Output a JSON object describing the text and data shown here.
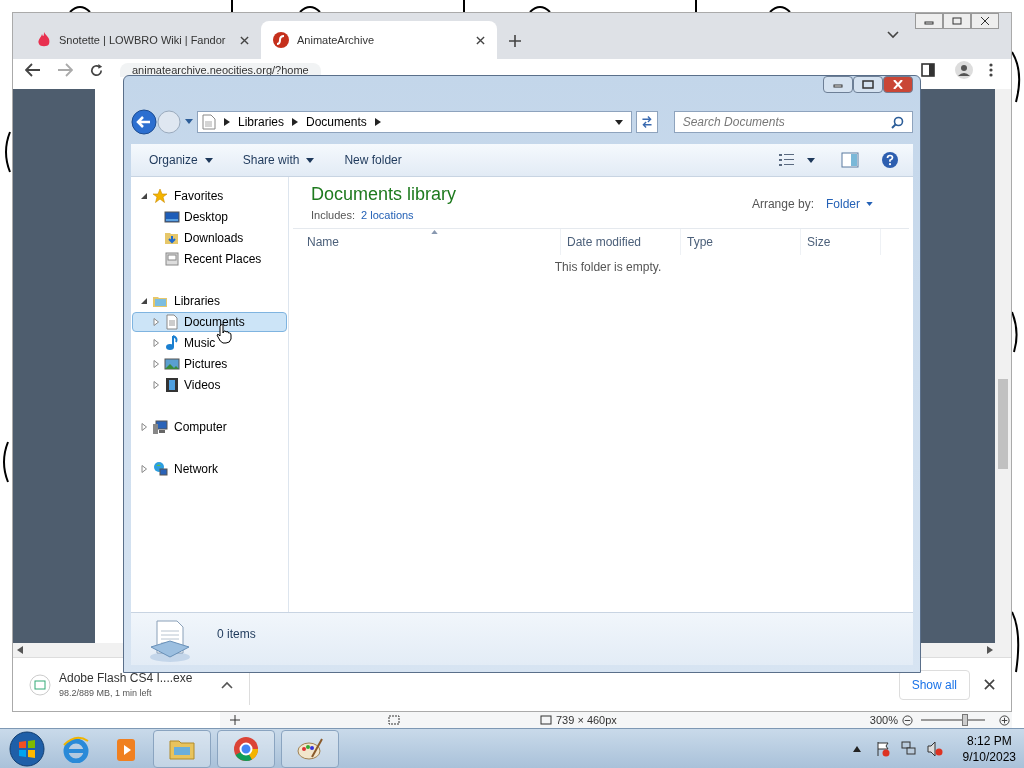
{
  "browser": {
    "tabs": [
      {
        "title": "Snotette | LOWBRO Wiki | Fandor",
        "selected": false
      },
      {
        "title": "AnimateArchive",
        "selected": true
      }
    ],
    "url": "animatearchive.neocities.org/?home",
    "download": {
      "filename": "Adobe Flash CS4 I....exe",
      "progress_text": "98.2/889 MB, 1 min left"
    },
    "show_all": "Show all"
  },
  "background_app_status": {
    "dimensions": "739 × 460px",
    "zoom": "300%",
    "zoom_slider": {
      "level": 0.7
    }
  },
  "explorer": {
    "breadcrumb": [
      "Libraries",
      "Documents"
    ],
    "search": {
      "placeholder": "Search Documents"
    },
    "toolbar": [
      {
        "label": "Organize",
        "has_menu": true
      },
      {
        "label": "Share with",
        "has_menu": true
      },
      {
        "label": "New folder",
        "has_menu": false
      }
    ],
    "nav": [
      {
        "label": "Favorites",
        "expanded": true,
        "children": [
          {
            "label": "Desktop",
            "selected": false
          },
          {
            "label": "Downloads",
            "selected": false
          },
          {
            "label": "Recent Places",
            "selected": false
          }
        ]
      },
      {
        "label": "Libraries",
        "expanded": true,
        "children": [
          {
            "label": "Documents",
            "selected": true,
            "expanded": false
          },
          {
            "label": "Music",
            "selected": false,
            "expanded": false
          },
          {
            "label": "Pictures",
            "selected": false,
            "expanded": false
          },
          {
            "label": "Videos",
            "selected": false,
            "expanded": false
          }
        ]
      },
      {
        "label": "Computer",
        "expanded": false
      },
      {
        "label": "Network",
        "expanded": false
      }
    ],
    "library_title": "Documents library",
    "includes_label": "Includes:",
    "locations_link": "2 locations",
    "arrange_label": "Arrange by:",
    "arrange_value": "Folder",
    "columns": [
      {
        "label": "Name",
        "sorted": true
      },
      {
        "label": "Date modified",
        "sorted": false
      },
      {
        "label": "Type",
        "sorted": false
      },
      {
        "label": "Size",
        "sorted": false
      }
    ],
    "empty_message": "This folder is empty.",
    "status": "0 items"
  },
  "taskbar": {
    "time": "8:12 PM",
    "date": "9/10/2023"
  }
}
